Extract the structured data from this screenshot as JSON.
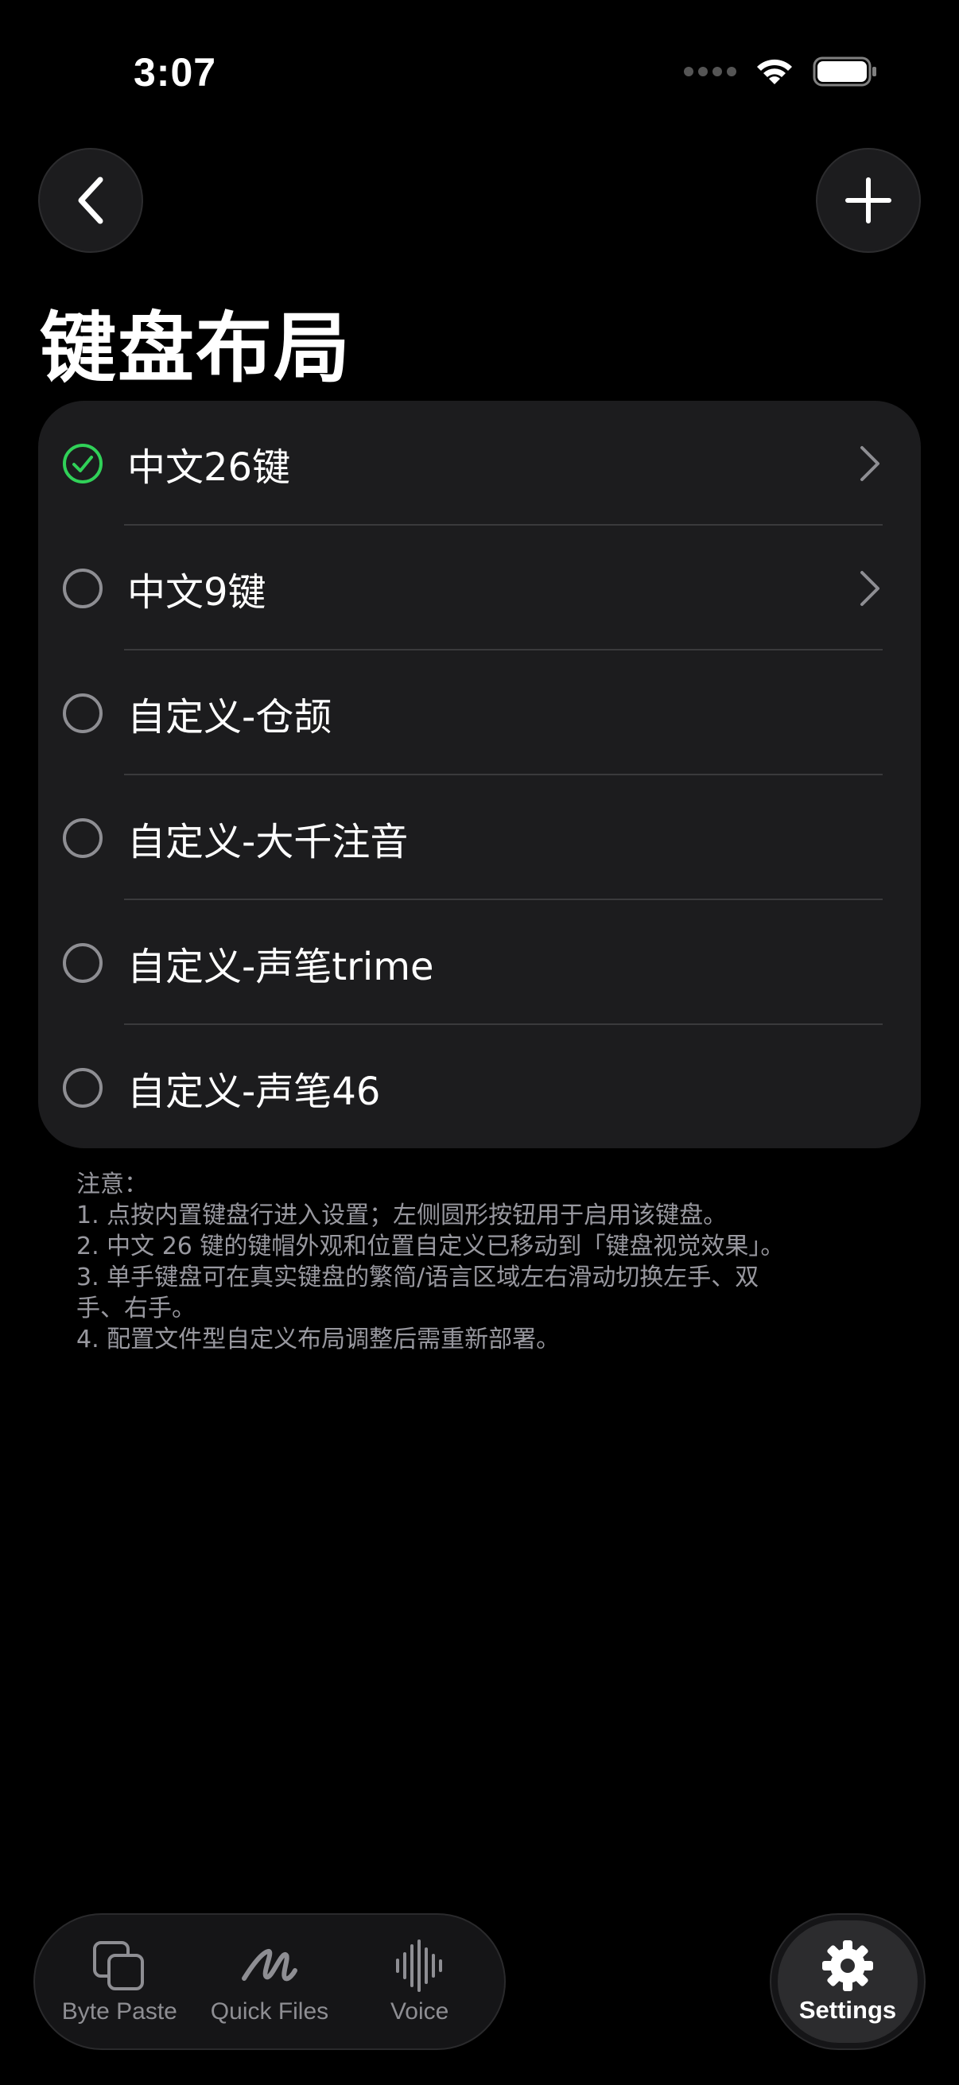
{
  "status_bar": {
    "time": "3:07"
  },
  "page": {
    "title": "键盘布局"
  },
  "layouts": [
    {
      "label": "中文26键",
      "selected": true,
      "has_chevron": true
    },
    {
      "label": "中文9键",
      "selected": false,
      "has_chevron": true
    },
    {
      "label": "自定义-仓颉",
      "selected": false,
      "has_chevron": false
    },
    {
      "label": "自定义-大千注音",
      "selected": false,
      "has_chevron": false
    },
    {
      "label": "自定义-声笔trime",
      "selected": false,
      "has_chevron": false
    },
    {
      "label": "自定义-声笔46",
      "selected": false,
      "has_chevron": false
    }
  ],
  "notes": {
    "heading": "注意：",
    "lines": [
      "1. 点按内置键盘行进入设置；左侧圆形按钮用于启用该键盘。",
      "2. 中文 26 键的键帽外观和位置自定义已移动到「键盘视觉效果」。",
      "3. 单手键盘可在真实键盘的繁简/语言区域左右滑动切换左手、双\n手、右手。",
      "4. 配置文件型自定义布局调整后需重新部署。"
    ]
  },
  "tabbar": {
    "tabs": [
      {
        "label": "Byte Paste",
        "icon": "copy-icon"
      },
      {
        "label": "Quick Files",
        "icon": "scribble-icon"
      },
      {
        "label": "Voice",
        "icon": "waveform-icon"
      }
    ],
    "settings": {
      "label": "Settings",
      "icon": "gear-icon"
    }
  },
  "colors": {
    "accent_selected": "#30d158",
    "card_bg": "#1c1c1e",
    "background": "#000000"
  }
}
